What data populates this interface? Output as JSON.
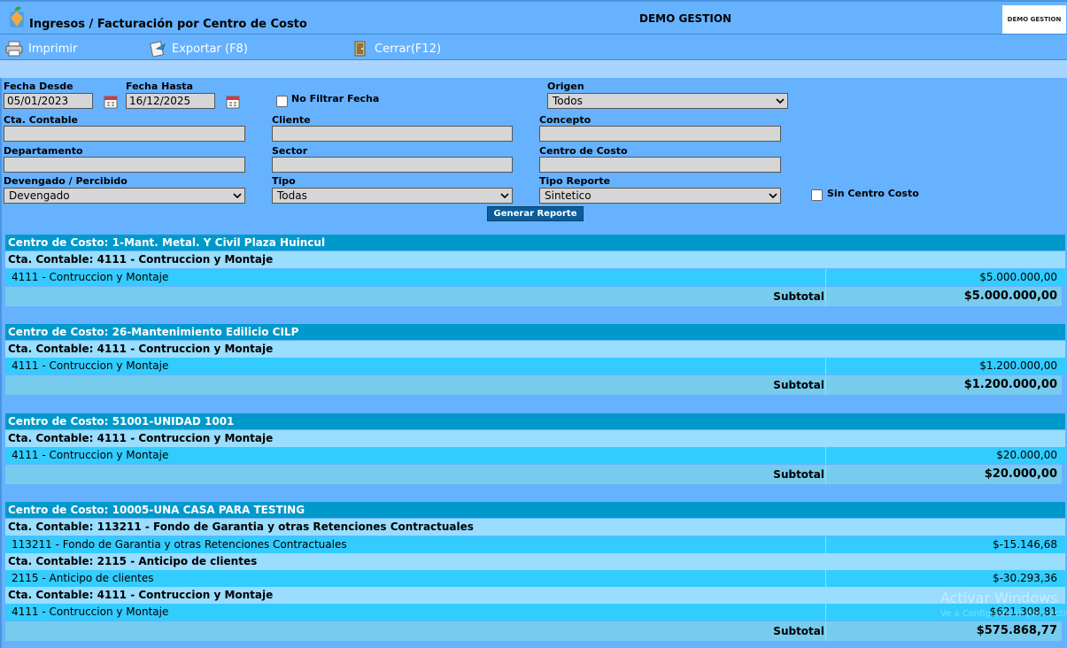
{
  "header": {
    "title": "Ingresos / Facturación por Centro de Costo",
    "company": "DEMO GESTION",
    "brand": "DEMO GESTION"
  },
  "toolbar": {
    "print_label": "Imprimir",
    "export_label": "Exportar (F8)",
    "close_label": "Cerrar(F12)"
  },
  "filters": {
    "fecha_desde_label": "Fecha Desde",
    "fecha_desde_value": "05/01/2023",
    "fecha_hasta_label": "Fecha Hasta",
    "fecha_hasta_value": "16/12/2025",
    "no_filtrar_label": "No Filtrar Fecha",
    "origen_label": "Origen",
    "origen_value": "Todos",
    "cta_contable_label": "Cta. Contable",
    "cliente_label": "Cliente",
    "concepto_label": "Concepto",
    "departamento_label": "Departamento",
    "sector_label": "Sector",
    "centro_costo_label": "Centro de Costo",
    "devengado_label": "Devengado / Percibido",
    "devengado_value": "Devengado",
    "tipo_label": "Tipo",
    "tipo_value": "Todas",
    "tipo_reporte_label": "Tipo Reporte",
    "tipo_reporte_value": "Sintetico",
    "sin_cc_label": "Sin Centro Costo",
    "generate_label": "Generar Reporte"
  },
  "report": {
    "subtotal_label": "Subtotal",
    "groups": [
      {
        "cc": "Centro de Costo: 1-Mant. Metal. Y Civil Plaza Huincul",
        "accounts": [
          {
            "header": "Cta. Contable: 4111 - Contruccion y Montaje",
            "line": "4111 - Contruccion y Montaje",
            "amount": "$5.000.000,00"
          }
        ],
        "subtotal": "$5.000.000,00"
      },
      {
        "cc": "Centro de Costo: 26-Mantenimiento Edilicio CILP",
        "accounts": [
          {
            "header": "Cta. Contable: 4111 - Contruccion y Montaje",
            "line": "4111 - Contruccion y Montaje",
            "amount": "$1.200.000,00"
          }
        ],
        "subtotal": "$1.200.000,00"
      },
      {
        "cc": "Centro de Costo: 51001-UNIDAD 1001",
        "accounts": [
          {
            "header": "Cta. Contable: 4111 - Contruccion y Montaje",
            "line": "4111 - Contruccion y Montaje",
            "amount": "$20.000,00"
          }
        ],
        "subtotal": "$20.000,00"
      },
      {
        "cc": "Centro de Costo: 10005-UNA CASA PARA TESTING",
        "accounts": [
          {
            "header": "Cta. Contable: 113211 - Fondo de Garantia y otras Retenciones Contractuales",
            "line": "113211 - Fondo de Garantia y otras Retenciones Contractuales",
            "amount": "$-15.146,68"
          },
          {
            "header": "Cta. Contable: 2115 - Anticipo de clientes",
            "line": "2115 - Anticipo de clientes",
            "amount": "$-30.293,36"
          },
          {
            "header": "Cta. Contable: 4111 - Contruccion y Montaje",
            "line": "4111 - Contruccion y Montaje",
            "amount": "$621.308,81"
          }
        ],
        "subtotal": "$575.868,77"
      }
    ]
  },
  "watermark": {
    "line1": "Activar Windows",
    "line2": "Ve a Configuración para activar Windows."
  }
}
